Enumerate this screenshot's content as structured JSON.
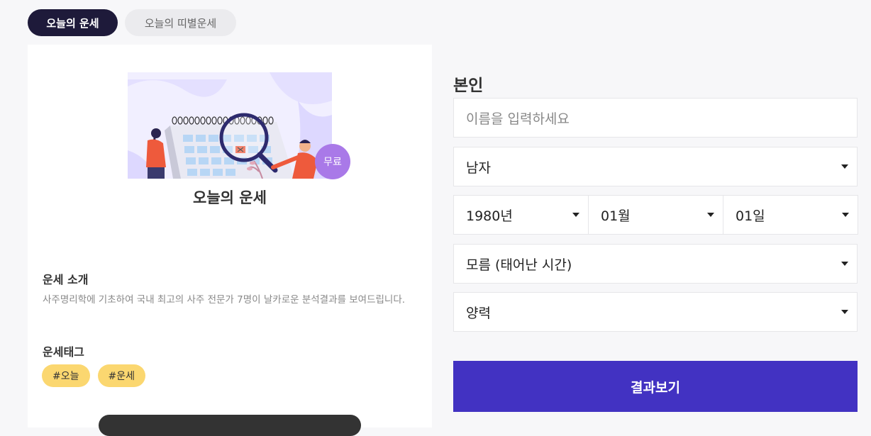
{
  "tabs": [
    {
      "label": "오늘의 운세",
      "active": true
    },
    {
      "label": "오늘의 띠별운세",
      "active": false
    }
  ],
  "card": {
    "badge": "무료",
    "title": "오늘의 운세",
    "intro_title": "운세 소개",
    "intro_text": "사주명리학에 기초하여 국내 최고의 사주 전문가 7명이 날카로운 분석결과를 보여드립니다.",
    "tag_title": "운세태그",
    "tags": [
      "#오늘",
      "#운세"
    ]
  },
  "form": {
    "label": "본인",
    "name_placeholder": "이름을 입력하세요",
    "gender": "남자",
    "year": "1980년",
    "month": "01월",
    "day": "01일",
    "birth_time": "모름 (태어난 시간)",
    "calendar": "양력",
    "submit": "결과보기"
  },
  "colors": {
    "tab_active_bg": "#1e1a3a",
    "submit_bg": "#4232c2",
    "tag_bg": "#fbd770",
    "badge_bg": "#a979e8"
  }
}
